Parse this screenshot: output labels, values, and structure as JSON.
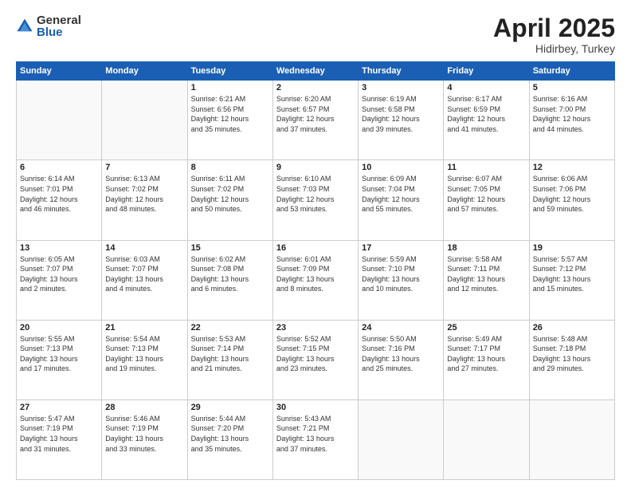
{
  "logo": {
    "general": "General",
    "blue": "Blue"
  },
  "title": {
    "month": "April 2025",
    "location": "Hidirbey, Turkey"
  },
  "weekdays": [
    "Sunday",
    "Monday",
    "Tuesday",
    "Wednesday",
    "Thursday",
    "Friday",
    "Saturday"
  ],
  "days": [
    {
      "num": "",
      "info": ""
    },
    {
      "num": "",
      "info": ""
    },
    {
      "num": "1",
      "info": "Sunrise: 6:21 AM\nSunset: 6:56 PM\nDaylight: 12 hours\nand 35 minutes."
    },
    {
      "num": "2",
      "info": "Sunrise: 6:20 AM\nSunset: 6:57 PM\nDaylight: 12 hours\nand 37 minutes."
    },
    {
      "num": "3",
      "info": "Sunrise: 6:19 AM\nSunset: 6:58 PM\nDaylight: 12 hours\nand 39 minutes."
    },
    {
      "num": "4",
      "info": "Sunrise: 6:17 AM\nSunset: 6:59 PM\nDaylight: 12 hours\nand 41 minutes."
    },
    {
      "num": "5",
      "info": "Sunrise: 6:16 AM\nSunset: 7:00 PM\nDaylight: 12 hours\nand 44 minutes."
    },
    {
      "num": "6",
      "info": "Sunrise: 6:14 AM\nSunset: 7:01 PM\nDaylight: 12 hours\nand 46 minutes."
    },
    {
      "num": "7",
      "info": "Sunrise: 6:13 AM\nSunset: 7:02 PM\nDaylight: 12 hours\nand 48 minutes."
    },
    {
      "num": "8",
      "info": "Sunrise: 6:11 AM\nSunset: 7:02 PM\nDaylight: 12 hours\nand 50 minutes."
    },
    {
      "num": "9",
      "info": "Sunrise: 6:10 AM\nSunset: 7:03 PM\nDaylight: 12 hours\nand 53 minutes."
    },
    {
      "num": "10",
      "info": "Sunrise: 6:09 AM\nSunset: 7:04 PM\nDaylight: 12 hours\nand 55 minutes."
    },
    {
      "num": "11",
      "info": "Sunrise: 6:07 AM\nSunset: 7:05 PM\nDaylight: 12 hours\nand 57 minutes."
    },
    {
      "num": "12",
      "info": "Sunrise: 6:06 AM\nSunset: 7:06 PM\nDaylight: 12 hours\nand 59 minutes."
    },
    {
      "num": "13",
      "info": "Sunrise: 6:05 AM\nSunset: 7:07 PM\nDaylight: 13 hours\nand 2 minutes."
    },
    {
      "num": "14",
      "info": "Sunrise: 6:03 AM\nSunset: 7:07 PM\nDaylight: 13 hours\nand 4 minutes."
    },
    {
      "num": "15",
      "info": "Sunrise: 6:02 AM\nSunset: 7:08 PM\nDaylight: 13 hours\nand 6 minutes."
    },
    {
      "num": "16",
      "info": "Sunrise: 6:01 AM\nSunset: 7:09 PM\nDaylight: 13 hours\nand 8 minutes."
    },
    {
      "num": "17",
      "info": "Sunrise: 5:59 AM\nSunset: 7:10 PM\nDaylight: 13 hours\nand 10 minutes."
    },
    {
      "num": "18",
      "info": "Sunrise: 5:58 AM\nSunset: 7:11 PM\nDaylight: 13 hours\nand 12 minutes."
    },
    {
      "num": "19",
      "info": "Sunrise: 5:57 AM\nSunset: 7:12 PM\nDaylight: 13 hours\nand 15 minutes."
    },
    {
      "num": "20",
      "info": "Sunrise: 5:55 AM\nSunset: 7:13 PM\nDaylight: 13 hours\nand 17 minutes."
    },
    {
      "num": "21",
      "info": "Sunrise: 5:54 AM\nSunset: 7:13 PM\nDaylight: 13 hours\nand 19 minutes."
    },
    {
      "num": "22",
      "info": "Sunrise: 5:53 AM\nSunset: 7:14 PM\nDaylight: 13 hours\nand 21 minutes."
    },
    {
      "num": "23",
      "info": "Sunrise: 5:52 AM\nSunset: 7:15 PM\nDaylight: 13 hours\nand 23 minutes."
    },
    {
      "num": "24",
      "info": "Sunrise: 5:50 AM\nSunset: 7:16 PM\nDaylight: 13 hours\nand 25 minutes."
    },
    {
      "num": "25",
      "info": "Sunrise: 5:49 AM\nSunset: 7:17 PM\nDaylight: 13 hours\nand 27 minutes."
    },
    {
      "num": "26",
      "info": "Sunrise: 5:48 AM\nSunset: 7:18 PM\nDaylight: 13 hours\nand 29 minutes."
    },
    {
      "num": "27",
      "info": "Sunrise: 5:47 AM\nSunset: 7:19 PM\nDaylight: 13 hours\nand 31 minutes."
    },
    {
      "num": "28",
      "info": "Sunrise: 5:46 AM\nSunset: 7:19 PM\nDaylight: 13 hours\nand 33 minutes."
    },
    {
      "num": "29",
      "info": "Sunrise: 5:44 AM\nSunset: 7:20 PM\nDaylight: 13 hours\nand 35 minutes."
    },
    {
      "num": "30",
      "info": "Sunrise: 5:43 AM\nSunset: 7:21 PM\nDaylight: 13 hours\nand 37 minutes."
    },
    {
      "num": "",
      "info": ""
    },
    {
      "num": "",
      "info": ""
    },
    {
      "num": "",
      "info": ""
    }
  ]
}
